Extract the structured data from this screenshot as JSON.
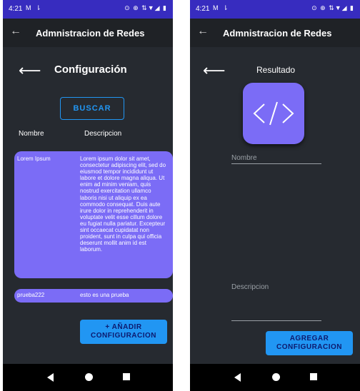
{
  "left": {
    "status": {
      "time": "4:21",
      "notifications": "M ⇂",
      "system": "⊙ ⊕ ⇅▼◢ ▮"
    },
    "appbar": {
      "back_icon": "←",
      "title": "Admnistracion de Redes"
    },
    "back_arrow": "⟵",
    "title": "Configuración",
    "search_button": "BUSCAR",
    "columns": {
      "name": "Nombre",
      "description": "Descripcion"
    },
    "configs": [
      {
        "name": "Lorem Ipsum",
        "description": "Lorem ipsum dolor sit amet, consectetur adipiscing elit, sed do eiusmod tempor incididunt ut labore et dolore magna aliqua. Ut enim ad minim veniam, quis nostrud exercitation ullamco laboris nisi ut aliquip ex ea commodo consequat. Duis aute irure dolor in reprehenderit in voluptate velit esse cillum dolore eu fugiat nulla pariatur. Excepteur sint occaecat cupidatat non proident, sunt in culpa qui officia deserunt mollit anim id est laborum."
      },
      {
        "name": "prueba222",
        "description": "esto es una prueba"
      }
    ],
    "add_button": {
      "line1": "+ AÑADIR",
      "line2": "CONFIGURACION"
    }
  },
  "right": {
    "status": {
      "time": "4:21",
      "notifications": "M ⇂",
      "system": "⊙ ⊕ ⇅▼◢ ▮"
    },
    "appbar": {
      "back_icon": "←",
      "title": "Admnistracion de Redes"
    },
    "back_arrow": "⟵",
    "title": "Resultado",
    "icon": "code-icon",
    "name_field_placeholder": "Nombre",
    "description_field_placeholder": "Descripcion",
    "add_button": {
      "line1": "AGREGAR",
      "line2": "CONFIGURACION"
    }
  },
  "colors": {
    "status_bar": "#372cbf",
    "app_bar": "#1f2226",
    "background": "#262a30",
    "card": "#7b6cf6",
    "accent_blue": "#2196f3",
    "button_text": "#0d1a6e"
  }
}
